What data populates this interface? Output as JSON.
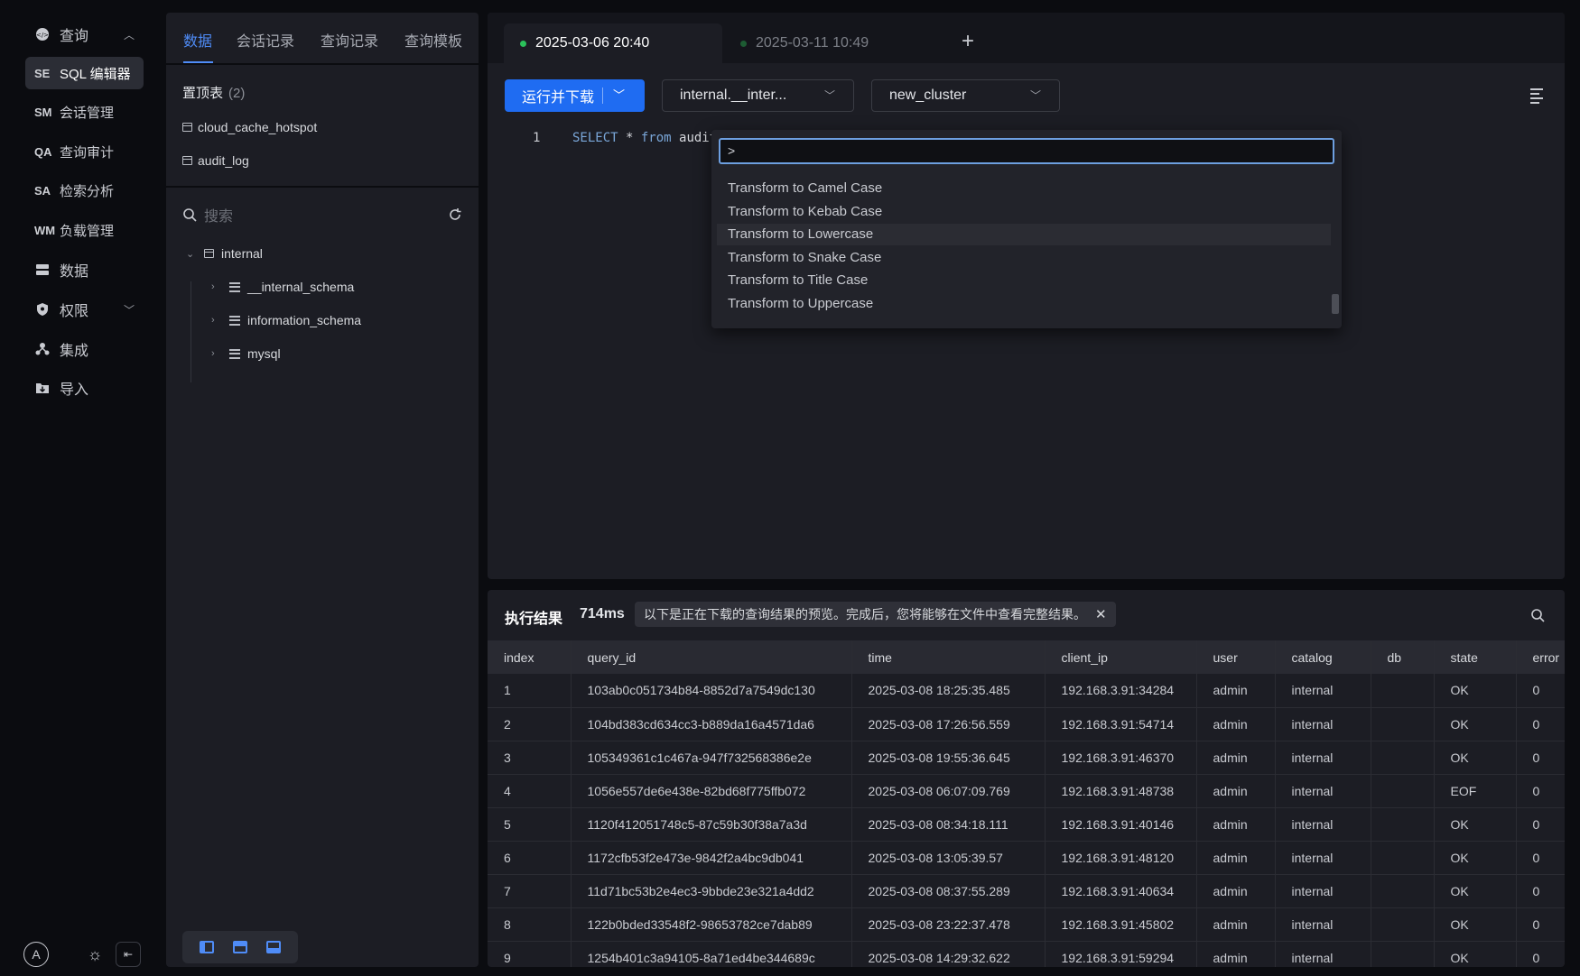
{
  "nav": {
    "items": [
      {
        "label": "查询",
        "abbr": "",
        "icon": "query-icon"
      },
      {
        "label": "SQL 编辑器",
        "abbr": "SE"
      },
      {
        "label": "会话管理",
        "abbr": "SM"
      },
      {
        "label": "查询审计",
        "abbr": "QA"
      },
      {
        "label": "检索分析",
        "abbr": "SA"
      },
      {
        "label": "负载管理",
        "abbr": "WM"
      },
      {
        "label": "数据",
        "icon": "database-icon"
      },
      {
        "label": "权限",
        "icon": "shield-icon"
      },
      {
        "label": "集成",
        "icon": "integration-icon"
      },
      {
        "label": "导入",
        "icon": "import-icon"
      }
    ],
    "avatar": "A"
  },
  "mid": {
    "tabs": [
      "数据",
      "会话记录",
      "查询记录",
      "查询模板"
    ],
    "pinned_title": "置顶表",
    "pinned_count": "(2)",
    "pinned": [
      "cloud_cache_hotspot",
      "audit_log"
    ],
    "search_placeholder": "搜索",
    "tree": {
      "catalog": "internal",
      "schemas": [
        "__internal_schema",
        "information_schema",
        "mysql"
      ]
    }
  },
  "editor": {
    "tabs": [
      {
        "label": "2025-03-06 20:40",
        "dot_color": "#2bc15a"
      },
      {
        "label": "2025-03-11 10:49",
        "dot_color": "#1d5c33"
      }
    ],
    "add_tab": "+",
    "run_label": "运行并下载",
    "catalog_select": "internal.__inter...",
    "cluster_select": "new_cluster",
    "line_number": "1",
    "code_kw1": "SELECT",
    "code_star": " * ",
    "code_kw2": "from",
    "code_rest": " audit",
    "palette": {
      "input": ">",
      "items": [
        "Transform to Camel Case",
        "Transform to Kebab Case",
        "Transform to Lowercase",
        "Transform to Snake Case",
        "Transform to Title Case",
        "Transform to Uppercase"
      ],
      "highlighted_index": 2
    }
  },
  "results": {
    "title": "执行结果",
    "elapsed": "714ms",
    "banner": "以下是正在下载的查询结果的预览。完成后，您将能够在文件中查看完整结果。",
    "columns": [
      "index",
      "query_id",
      "time",
      "client_ip",
      "user",
      "catalog",
      "db",
      "state",
      "error"
    ],
    "rows": [
      [
        "1",
        "103ab0c051734b84-8852d7a7549dc130",
        "2025-03-08 18:25:35.485",
        "192.168.3.91:34284",
        "admin",
        "internal",
        "",
        "OK",
        "0"
      ],
      [
        "2",
        "104bd383cd634cc3-b889da16a4571da6",
        "2025-03-08 17:26:56.559",
        "192.168.3.91:54714",
        "admin",
        "internal",
        "",
        "OK",
        "0"
      ],
      [
        "3",
        "105349361c1c467a-947f732568386e2e",
        "2025-03-08 19:55:36.645",
        "192.168.3.91:46370",
        "admin",
        "internal",
        "",
        "OK",
        "0"
      ],
      [
        "4",
        "1056e557de6e438e-82bd68f775ffb072",
        "2025-03-08 06:07:09.769",
        "192.168.3.91:48738",
        "admin",
        "internal",
        "",
        "EOF",
        "0"
      ],
      [
        "5",
        "1120f412051748c5-87c59b30f38a7a3d",
        "2025-03-08 08:34:18.111",
        "192.168.3.91:40146",
        "admin",
        "internal",
        "",
        "OK",
        "0"
      ],
      [
        "6",
        "1172cfb53f2e473e-9842f2a4bc9db041",
        "2025-03-08 13:05:39.57",
        "192.168.3.91:48120",
        "admin",
        "internal",
        "",
        "OK",
        "0"
      ],
      [
        "7",
        "11d71bc53b2e4ec3-9bbde23e321a4dd2",
        "2025-03-08 08:37:55.289",
        "192.168.3.91:40634",
        "admin",
        "internal",
        "",
        "OK",
        "0"
      ],
      [
        "8",
        "122b0bded33548f2-98653782ce7dab89",
        "2025-03-08 23:22:37.478",
        "192.168.3.91:45802",
        "admin",
        "internal",
        "",
        "OK",
        "0"
      ],
      [
        "9",
        "1254b401c3a94105-8a71ed4be344689c",
        "2025-03-08 14:29:32.622",
        "192.168.3.91:59294",
        "admin",
        "internal",
        "",
        "OK",
        "0"
      ]
    ]
  }
}
